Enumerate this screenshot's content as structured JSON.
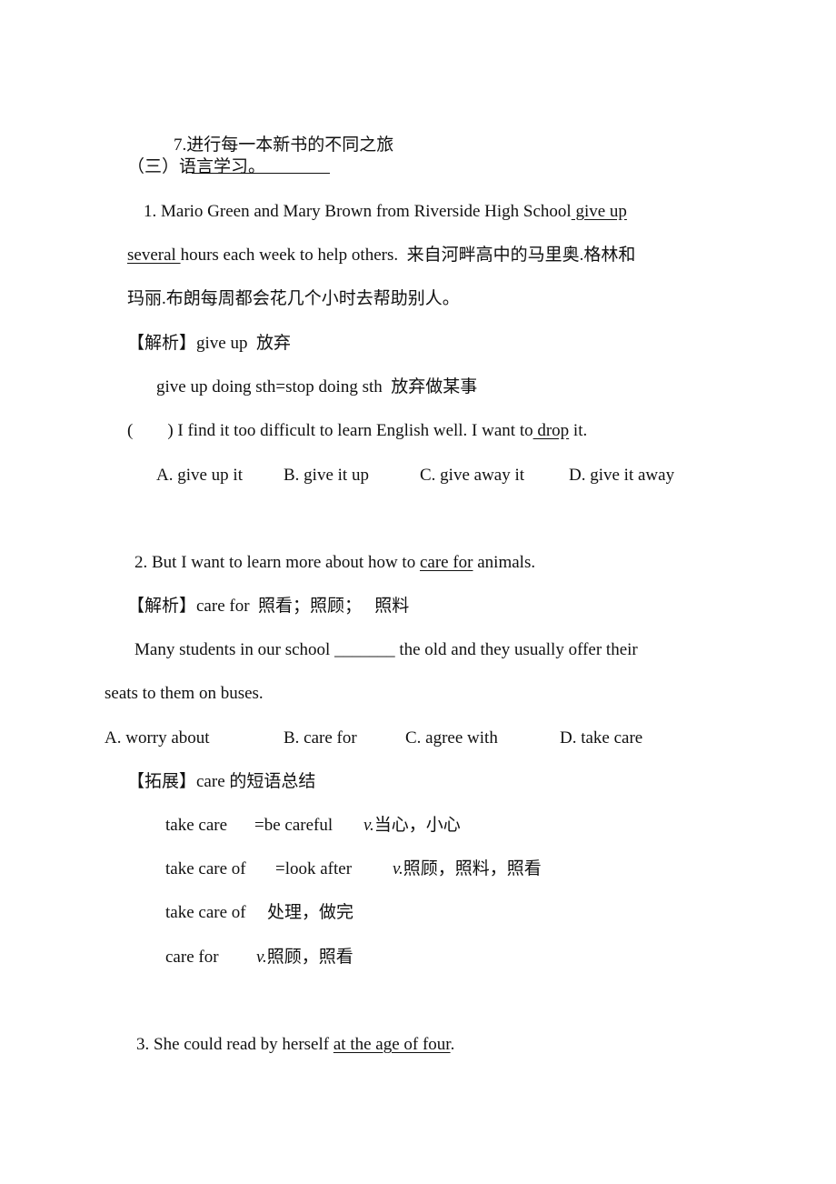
{
  "item7": {
    "text": "7.进行每一本新书的不同之旅"
  },
  "section3": {
    "title": "（三）语言学习。"
  },
  "q1": {
    "line1_pre": "1. Mario Green and Mary Brown from Riverside High School",
    "line1_u": " give up",
    "line2_u": "several ",
    "line2_post": "hours each week to help others.  来自河畔高中的马里奥.格林和",
    "line3": "玛丽.布朗每周都会花几个小时去帮助别人。",
    "analysis": "【解析】give up  放弃",
    "usage": "give up doing sth=stop doing sth  放弃做某事",
    "exercise_pre": "(        ) I find it too difficult to learn English well. I want to",
    "exercise_u": " drop",
    "exercise_post": " it.",
    "options": [
      "A. give up it",
      "B. give it up",
      "C. give away it",
      "D. give it away"
    ]
  },
  "q2": {
    "sentence_pre": "2. But I want to learn more about how to ",
    "sentence_u": "care for",
    "sentence_post": " animals.",
    "analysis": "【解析】care for  照看；照顾；   照料",
    "exercise_line1": "Many students in our school _______ the old and they usually offer their",
    "exercise_line2": "seats to them on buses.",
    "options": [
      "A. worry about",
      "B. care for",
      "C. agree with",
      "D. take care"
    ],
    "expand_title": "【拓展】care 的短语总结",
    "phrases": [
      {
        "en": "take care",
        "eq": "=be careful",
        "pos": "v.",
        "cn": "当心，小心"
      },
      {
        "en": "take care of",
        "eq": "=look after",
        "pos": "v.",
        "cn": "照顾，照料，照看"
      },
      {
        "en": "take care of",
        "eq": "",
        "pos": "",
        "cn": "处理，做完"
      },
      {
        "en": "care for",
        "eq": "",
        "pos": "v.",
        "cn": "照顾，照看"
      }
    ]
  },
  "q3": {
    "sentence_pre": "3. She could read by herself ",
    "sentence_u": "at the age of four",
    "sentence_post": "."
  }
}
